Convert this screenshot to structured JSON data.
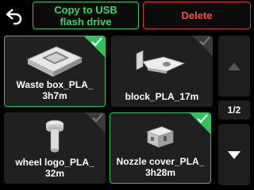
{
  "header": {
    "copy_label": "Copy to USB\nflash drive",
    "delete_label": "Delete"
  },
  "files": [
    {
      "name": "Waste box_PLA_\n3h7m",
      "selected": true,
      "icon": "waste-box-model-icon"
    },
    {
      "name": "block_PLA_17m",
      "selected": false,
      "icon": "block-model-icon"
    },
    {
      "name": "wheel logo_PLA_\n32m",
      "selected": false,
      "icon": "wheel-logo-model-icon"
    },
    {
      "name": "Nozzle cover_PLA_\n3h28m",
      "selected": true,
      "icon": "nozzle-cover-model-icon"
    }
  ],
  "pager": {
    "indicator": "1/2"
  },
  "colors": {
    "accent_green": "#2ec45a",
    "delete_red": "#ff4a42",
    "card_bg": "#202020"
  }
}
